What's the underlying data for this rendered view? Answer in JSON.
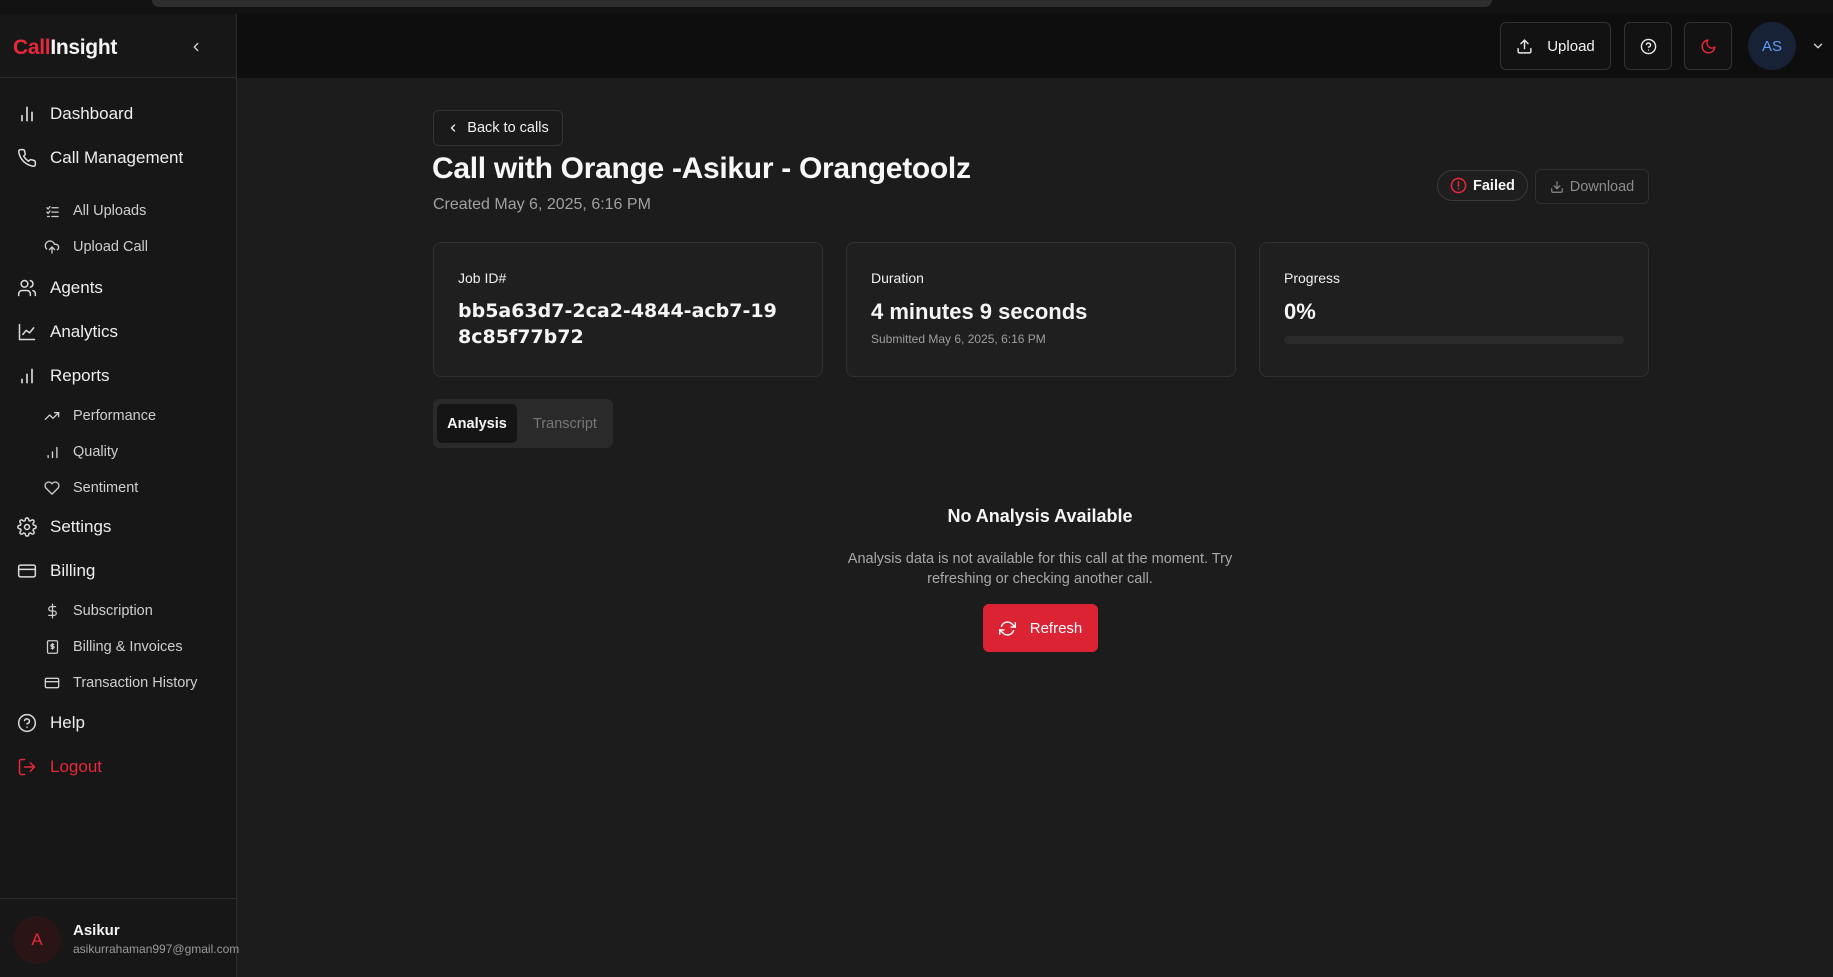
{
  "brand": {
    "part1": "Call",
    "part2": "Insight"
  },
  "sidebar": {
    "items": [
      {
        "label": "Dashboard",
        "icon": "bar-chart-icon"
      },
      {
        "label": "Call Management",
        "icon": "phone-icon"
      },
      {
        "label": "All Uploads",
        "icon": "list-check-icon"
      },
      {
        "label": "Upload Call",
        "icon": "cloud-upload-icon"
      },
      {
        "label": "Agents",
        "icon": "users-icon"
      },
      {
        "label": "Analytics",
        "icon": "line-chart-icon"
      },
      {
        "label": "Reports",
        "icon": "bar-chart-icon"
      },
      {
        "label": "Performance",
        "icon": "trending-up-icon"
      },
      {
        "label": "Quality",
        "icon": "signal-bars-icon"
      },
      {
        "label": "Sentiment",
        "icon": "heart-icon"
      },
      {
        "label": "Settings",
        "icon": "gear-icon"
      },
      {
        "label": "Billing",
        "icon": "credit-card-icon"
      },
      {
        "label": "Subscription",
        "icon": "dollar-icon"
      },
      {
        "label": "Billing & Invoices",
        "icon": "receipt-icon"
      },
      {
        "label": "Transaction History",
        "icon": "credit-card-icon"
      },
      {
        "label": "Help",
        "icon": "help-circle-icon"
      },
      {
        "label": "Logout",
        "icon": "logout-icon"
      }
    ]
  },
  "user": {
    "initial": "A",
    "name": "Asikur",
    "email": "asikurrahaman997@gmail.com"
  },
  "header": {
    "upload_label": "Upload",
    "avatar_initials": "AS"
  },
  "main": {
    "back_label": "Back to calls",
    "title": "Call with Orange -Asikur - Orangetoolz",
    "created": "Created May 6, 2025, 6:16 PM",
    "status": "Failed",
    "download_label": "Download",
    "cards": {
      "job": {
        "label": "Job ID#",
        "value": "bb5a63d7-2ca2-4844-acb7-198c85f77b72"
      },
      "duration": {
        "label": "Duration",
        "value": "4 minutes 9 seconds",
        "sub": "Submitted May 6, 2025, 6:16 PM"
      },
      "progress": {
        "label": "Progress",
        "value": "0%",
        "fraction": 0
      }
    },
    "tabs": [
      {
        "label": "Analysis",
        "active": true
      },
      {
        "label": "Transcript",
        "active": false
      }
    ],
    "empty": {
      "title": "No Analysis Available",
      "text": "Analysis data is not available for this call at the moment. Try refreshing or checking another call.",
      "refresh_label": "Refresh"
    }
  },
  "colors": {
    "accent": "#e5283a",
    "avatar_blue": "#5f9ef0"
  }
}
